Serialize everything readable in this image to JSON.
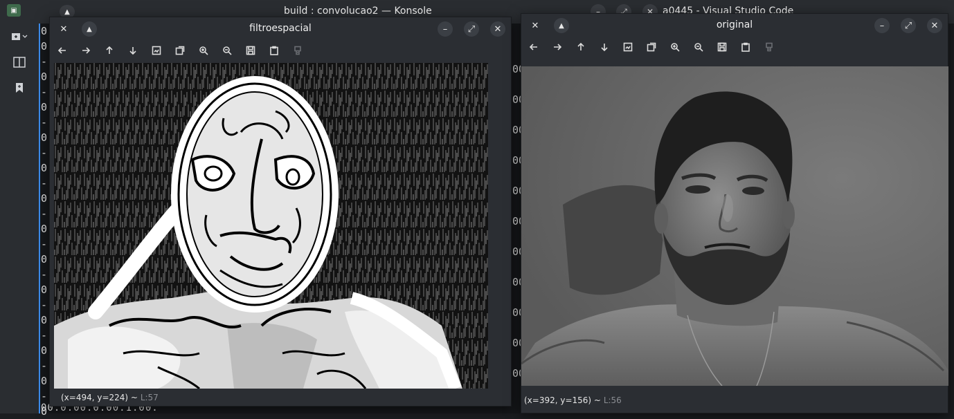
{
  "konsole": {
    "title": "build : convolucao2 — Konsole",
    "terminal_lines": [
      "0",
      "0",
      "-",
      "0",
      "-",
      "0",
      "-",
      "0",
      "-",
      "0",
      "-",
      "0",
      "-",
      "0",
      "-",
      "0",
      "-",
      "0",
      "-",
      "0",
      "-",
      "0",
      "-",
      "0",
      "-",
      "0"
    ],
    "terminal_bottom": "00.0.00.0.00.1.00."
  },
  "vscode": {
    "title": "a0445 - Visual Studio Code",
    "editor_lines": [
      "00",
      "00",
      "00",
      "00",
      "00",
      "00",
      "00",
      "00",
      "00",
      "00",
      "00"
    ]
  },
  "filtro_window": {
    "title": "filtroespacial",
    "status_coords": "(x=494, y=224) ~",
    "status_level": "L:57"
  },
  "original_window": {
    "title": "original",
    "status_coords": "(x=392, y=156) ~",
    "status_level": "L:56"
  },
  "toolbar_icons": [
    "arrow-left-icon",
    "arrow-right-icon",
    "arrow-up-icon",
    "arrow-down-icon",
    "zoom-fit-icon",
    "zoom-original-icon",
    "zoom-in-icon",
    "zoom-out-icon",
    "save-icon",
    "copy-icon",
    "properties-icon"
  ],
  "colors": {
    "window_bg": "#2b2e33",
    "accent": "#3d8ef0"
  }
}
